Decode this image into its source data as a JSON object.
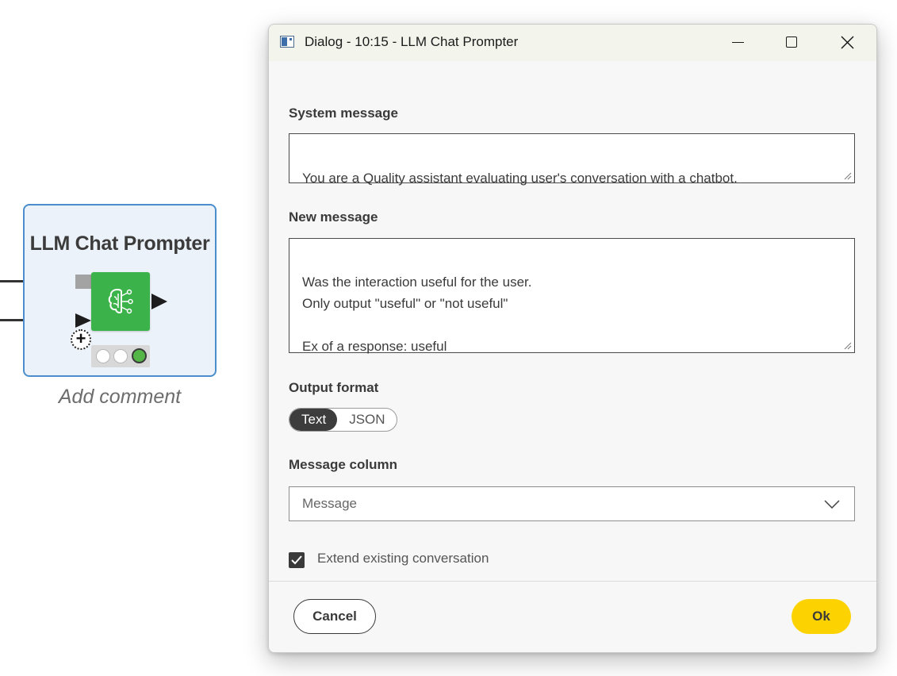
{
  "workflow": {
    "node": {
      "title": "LLM Chat Prompter",
      "icon": "brain-network-icon",
      "status": "executed",
      "status_color": "#55b648",
      "body_color": "#3cb34a",
      "comment_placeholder": "Add comment"
    }
  },
  "dialog": {
    "title": "Dialog - 10:15 - LLM Chat Prompter",
    "window_controls": [
      "minimize-icon",
      "maximize-icon",
      "close-icon"
    ],
    "system_message": {
      "label": "System message",
      "value": "You are a Quality assistant evaluating user's conversation with a chatbot."
    },
    "new_message": {
      "label": "New message",
      "value": "Was the interaction useful for the user.\nOnly output \"useful\" or \"not useful\"\n\nEx of a response: useful"
    },
    "output_format": {
      "label": "Output format",
      "options": [
        "Text",
        "JSON"
      ],
      "selected": "Text"
    },
    "message_column": {
      "label": "Message column",
      "value": "Message"
    },
    "extend_conversation": {
      "label": "Extend existing conversation",
      "checked": true
    },
    "footer": {
      "cancel_label": "Cancel",
      "ok_label": "Ok",
      "ok_color": "#fcd200"
    }
  }
}
